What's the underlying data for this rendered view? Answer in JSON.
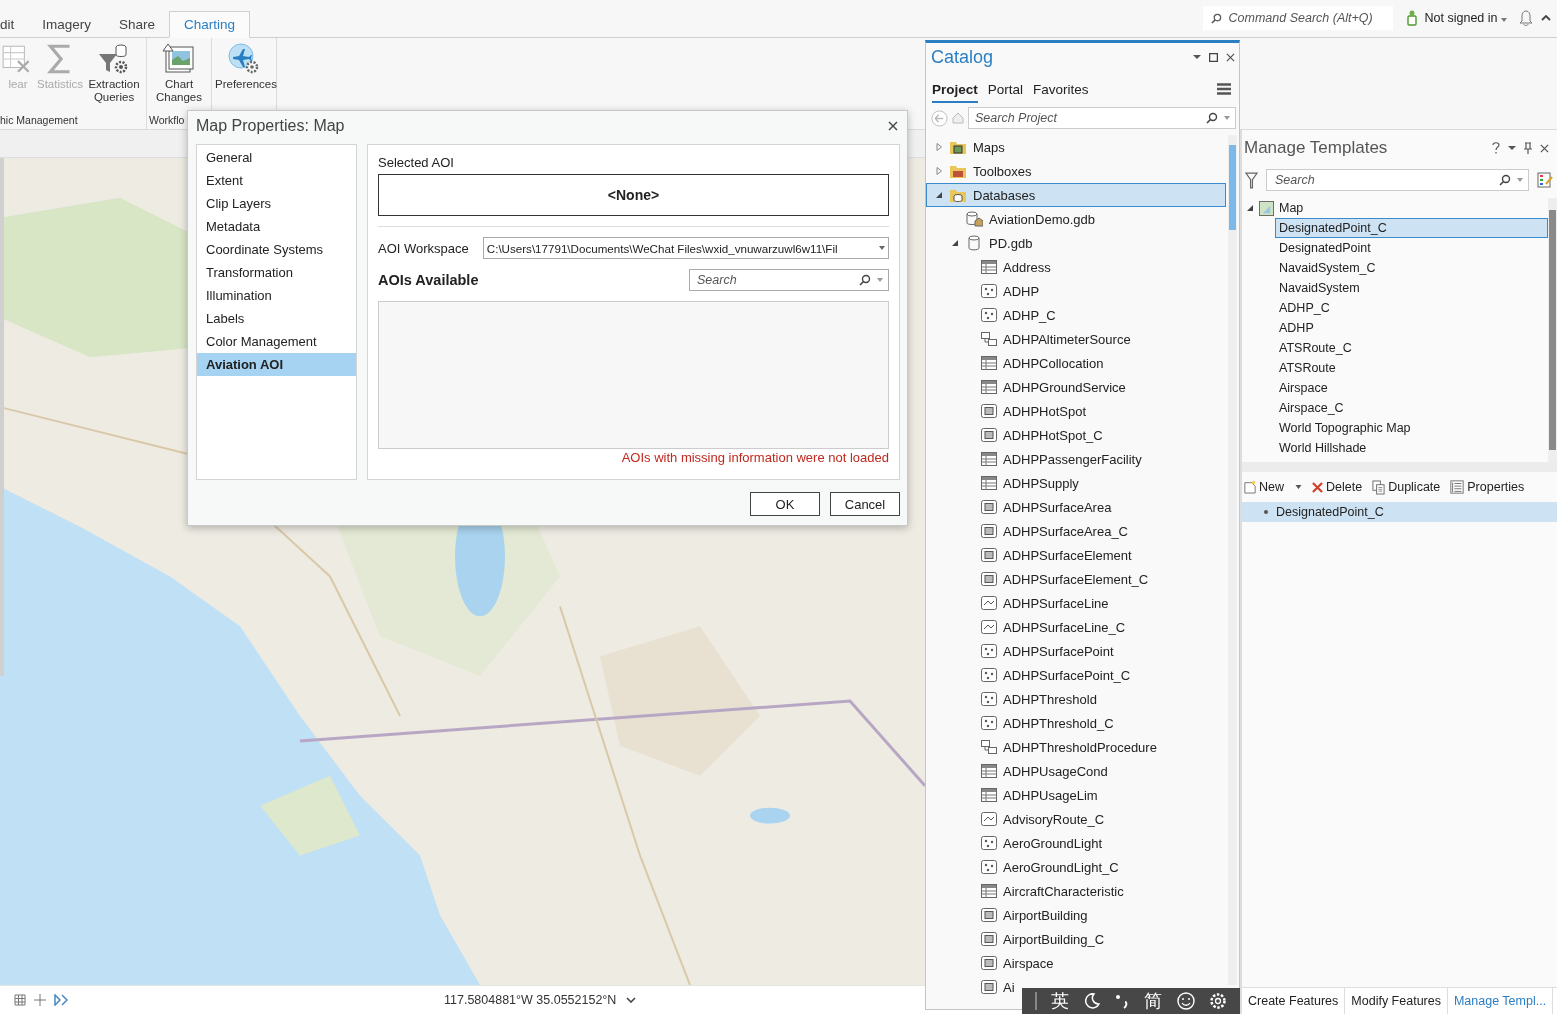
{
  "ribbon": {
    "tabs": [
      {
        "label": "dit",
        "selected": false
      },
      {
        "label": "Imagery",
        "selected": false
      },
      {
        "label": "Share",
        "selected": false
      },
      {
        "label": "Charting",
        "selected": true
      }
    ],
    "command_search": {
      "placeholder": "Command Search (Alt+Q)"
    },
    "account": "Not signed in",
    "groups": [
      {
        "label": "hic Management",
        "buttons": [
          {
            "label": "lear",
            "kind": "clear",
            "disabled": true
          },
          {
            "label": "Statistics",
            "kind": "statistics",
            "disabled": true
          },
          {
            "label": "Extraction Queries",
            "kind": "extraction",
            "disabled": false
          }
        ]
      },
      {
        "label": "Workflo",
        "buttons": [
          {
            "label": "Chart Changes",
            "kind": "chart",
            "disabled": false
          }
        ]
      },
      {
        "buttons": [
          {
            "label": "Preferences",
            "kind": "preferences",
            "disabled": false
          }
        ]
      }
    ]
  },
  "dialog": {
    "title": "Map Properties: Map",
    "nav": [
      {
        "label": "General",
        "selected": false
      },
      {
        "label": "Extent",
        "selected": false
      },
      {
        "label": "Clip Layers",
        "selected": false
      },
      {
        "label": "Metadata",
        "selected": false
      },
      {
        "label": "Coordinate Systems",
        "selected": false
      },
      {
        "label": "Transformation",
        "selected": false
      },
      {
        "label": "Illumination",
        "selected": false
      },
      {
        "label": "Labels",
        "selected": false
      },
      {
        "label": "Color Management",
        "selected": false
      },
      {
        "label": "Aviation AOI",
        "selected": true
      }
    ],
    "selected_aoi": {
      "label": "Selected AOI",
      "value": "<None>"
    },
    "workspace": {
      "label": "AOI Workspace",
      "value": "C:\\Users\\17791\\Documents\\WeChat Files\\wxid_vnuwarzuwl6w11\\Fil"
    },
    "aois_heading": "AOIs Available",
    "search": {
      "placeholder": "Search"
    },
    "warning": "AOIs with missing information were not loaded",
    "buttons": [
      "OK",
      "Cancel"
    ]
  },
  "catalog": {
    "title": "Catalog",
    "tabs": [
      {
        "label": "Project",
        "selected": true
      },
      {
        "label": "Portal",
        "selected": false
      },
      {
        "label": "Favorites",
        "selected": false
      }
    ],
    "search": {
      "placeholder": "Search Project"
    },
    "tree": [
      {
        "label": "Maps",
        "kind": "maps",
        "expanded": false,
        "selected": false
      },
      {
        "label": "Toolboxes",
        "kind": "toolboxes",
        "expanded": false,
        "selected": false
      },
      {
        "label": "Databases",
        "kind": "databases",
        "expanded": true,
        "selected": true,
        "children": [
          {
            "label": "AviationDemo.gdb",
            "kind": "home-gdb",
            "selected": false
          },
          {
            "label": "PD.gdb",
            "kind": "gdb",
            "expanded": true,
            "selected": false,
            "children": [
              {
                "label": "Address",
                "kind": "table",
                "selected": false
              },
              {
                "label": "ADHP",
                "kind": "point",
                "selected": false
              },
              {
                "label": "ADHP_C",
                "kind": "point",
                "selected": false
              },
              {
                "label": "ADHPAltimeterSource",
                "kind": "relationship",
                "selected": false
              },
              {
                "label": "ADHPCollocation",
                "kind": "table",
                "selected": false
              },
              {
                "label": "ADHPGroundService",
                "kind": "table",
                "selected": false
              },
              {
                "label": "ADHPHotSpot",
                "kind": "polygon",
                "selected": false
              },
              {
                "label": "ADHPHotSpot_C",
                "kind": "polygon",
                "selected": false
              },
              {
                "label": "ADHPPassengerFacility",
                "kind": "table",
                "selected": false
              },
              {
                "label": "ADHPSupply",
                "kind": "table",
                "selected": false
              },
              {
                "label": "ADHPSurfaceArea",
                "kind": "polygon",
                "selected": false
              },
              {
                "label": "ADHPSurfaceArea_C",
                "kind": "polygon",
                "selected": false
              },
              {
                "label": "ADHPSurfaceElement",
                "kind": "polygon",
                "selected": false
              },
              {
                "label": "ADHPSurfaceElement_C",
                "kind": "polygon",
                "selected": false
              },
              {
                "label": "ADHPSurfaceLine",
                "kind": "line",
                "selected": false
              },
              {
                "label": "ADHPSurfaceLine_C",
                "kind": "line",
                "selected": false
              },
              {
                "label": "ADHPSurfacePoint",
                "kind": "point",
                "selected": false
              },
              {
                "label": "ADHPSurfacePoint_C",
                "kind": "point",
                "selected": false
              },
              {
                "label": "ADHPThreshold",
                "kind": "point",
                "selected": false
              },
              {
                "label": "ADHPThreshold_C",
                "kind": "point",
                "selected": false
              },
              {
                "label": "ADHPThresholdProcedure",
                "kind": "relationship",
                "selected": false
              },
              {
                "label": "ADHPUsageCond",
                "kind": "table",
                "selected": false
              },
              {
                "label": "ADHPUsageLim",
                "kind": "table",
                "selected": false
              },
              {
                "label": "AdvisoryRoute_C",
                "kind": "line",
                "selected": false
              },
              {
                "label": "AeroGroundLight",
                "kind": "point",
                "selected": false
              },
              {
                "label": "AeroGroundLight_C",
                "kind": "point",
                "selected": false
              },
              {
                "label": "AircraftCharacteristic",
                "kind": "table",
                "selected": false
              },
              {
                "label": "AirportBuilding",
                "kind": "polygon",
                "selected": false
              },
              {
                "label": "AirportBuilding_C",
                "kind": "polygon",
                "selected": false
              },
              {
                "label": "Airspace",
                "kind": "polygon",
                "selected": false
              },
              {
                "label": "Ai",
                "kind": "polygon",
                "selected": false
              }
            ]
          }
        ]
      }
    ]
  },
  "templates": {
    "title": "Manage Templates",
    "search": {
      "placeholder": "Search"
    },
    "tree": [
      {
        "label": "Map",
        "expanded": true,
        "children": [
          {
            "label": "DesignatedPoint_C",
            "selected": true
          },
          {
            "label": "DesignatedPoint",
            "selected": false
          },
          {
            "label": "NavaidSystem_C",
            "selected": false
          },
          {
            "label": "NavaidSystem",
            "selected": false
          },
          {
            "label": "ADHP_C",
            "selected": false
          },
          {
            "label": "ADHP",
            "selected": false
          },
          {
            "label": "ATSRoute_C",
            "selected": false
          },
          {
            "label": "ATSRoute",
            "selected": false
          },
          {
            "label": "Airspace",
            "selected": false
          },
          {
            "label": "Airspace_C",
            "selected": false
          },
          {
            "label": "World Topographic Map",
            "selected": false
          },
          {
            "label": "World Hillshade",
            "selected": false
          }
        ]
      }
    ],
    "toolbar": [
      {
        "label": "New",
        "kind": "new"
      },
      {
        "label": "Delete",
        "kind": "delete"
      },
      {
        "label": "Duplicate",
        "kind": "duplicate"
      },
      {
        "label": "Properties",
        "kind": "properties"
      }
    ],
    "selected_list": [
      {
        "label": "DesignatedPoint_C",
        "selected": true
      }
    ],
    "bottom_tabs": [
      {
        "label": "Create Features",
        "selected": false
      },
      {
        "label": "Modify Features",
        "selected": false
      },
      {
        "label": "Manage Templ...",
        "selected": true
      }
    ]
  },
  "status_bar": {
    "coordinates": "117.5804881°W 35.0552152°N"
  },
  "ime": {
    "language": "英",
    "script": "简"
  }
}
